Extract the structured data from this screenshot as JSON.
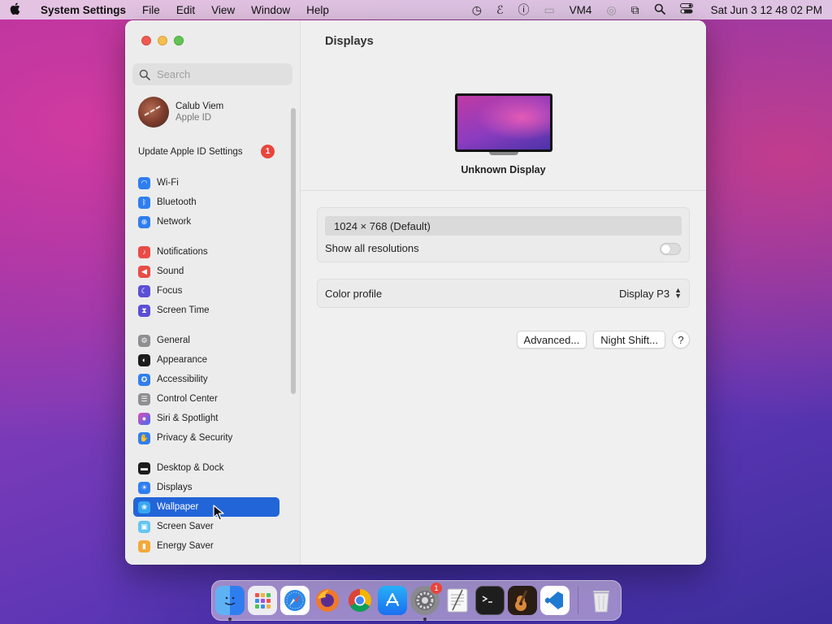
{
  "menubar": {
    "app_name": "System Settings",
    "menus": [
      "File",
      "Edit",
      "View",
      "Window",
      "Help"
    ],
    "status_text": "VM4",
    "clock": "Sat Jun 3  12 48 02 PM"
  },
  "search": {
    "placeholder": "Search"
  },
  "profile": {
    "name": "Calub Viem",
    "subtitle": "Apple ID"
  },
  "update": {
    "label": "Update Apple ID Settings",
    "badge": "1"
  },
  "sidebar": {
    "group1": [
      {
        "label": "Wi-Fi",
        "icon": "wifi-icon",
        "color": "#2f7ef0"
      },
      {
        "label": "Bluetooth",
        "icon": "bluetooth-icon",
        "color": "#2f7ef0"
      },
      {
        "label": "Network",
        "icon": "globe-icon",
        "color": "#2f7ef0"
      }
    ],
    "group2": [
      {
        "label": "Notifications",
        "icon": "bell-icon",
        "color": "#ea4b46"
      },
      {
        "label": "Sound",
        "icon": "speaker-icon",
        "color": "#ea4b46"
      },
      {
        "label": "Focus",
        "icon": "moon-icon",
        "color": "#5b4fd6"
      },
      {
        "label": "Screen Time",
        "icon": "hourglass-icon",
        "color": "#5b4fd6"
      }
    ],
    "group3": [
      {
        "label": "General",
        "icon": "gear-icon",
        "color": "#8e8e93"
      },
      {
        "label": "Appearance",
        "icon": "appearance-icon",
        "color": "#1c1c1e"
      },
      {
        "label": "Accessibility",
        "icon": "accessibility-icon",
        "color": "#2f7ef0"
      },
      {
        "label": "Control Center",
        "icon": "toggles-icon",
        "color": "#8e8e93"
      },
      {
        "label": "Siri & Spotlight",
        "icon": "siri-icon",
        "color": "#c04ad0"
      },
      {
        "label": "Privacy & Security",
        "icon": "hand-icon",
        "color": "#2f7ef0"
      }
    ],
    "group4": [
      {
        "label": "Desktop & Dock",
        "icon": "dock-icon",
        "color": "#1c1c1e"
      },
      {
        "label": "Displays",
        "icon": "sun-icon",
        "color": "#2f7ef0"
      },
      {
        "label": "Wallpaper",
        "icon": "wallpaper-icon",
        "color": "#35a7f0",
        "selected": true
      },
      {
        "label": "Screen Saver",
        "icon": "screensaver-icon",
        "color": "#63c5f0"
      },
      {
        "label": "Energy Saver",
        "icon": "battery-icon",
        "color": "#f2a93b"
      }
    ]
  },
  "content": {
    "title": "Displays",
    "display_name": "Unknown Display",
    "resolution": "1024 × 768 (Default)",
    "show_all_label": "Show all resolutions",
    "show_all_enabled": false,
    "color_profile_label": "Color profile",
    "color_profile_value": "Display P3",
    "advanced_label": "Advanced...",
    "night_shift_label": "Night Shift...",
    "help_label": "?"
  },
  "dock": {
    "items": [
      {
        "name": "finder-icon",
        "color": "#3a8ef0",
        "running": true
      },
      {
        "name": "launchpad-icon",
        "color": "#e9e9ef"
      },
      {
        "name": "safari-icon",
        "color": "#2c86e8"
      },
      {
        "name": "firefox-icon",
        "color": "#5c2d91"
      },
      {
        "name": "chrome-icon",
        "color": "#f2f2f2"
      },
      {
        "name": "app-store-icon",
        "color": "#1f8cf0"
      },
      {
        "name": "system-settings-icon",
        "color": "#8a8a8e",
        "running": true,
        "badge": "1"
      },
      {
        "name": "textedit-icon",
        "color": "#f5f5f5"
      },
      {
        "name": "terminal-icon",
        "color": "#1e1e1e"
      },
      {
        "name": "garageband-icon",
        "color": "#3a2a1e"
      },
      {
        "name": "vscode-icon",
        "color": "#ffffff"
      },
      {
        "name": "trash-icon",
        "color": "#dcdcdc"
      }
    ]
  }
}
